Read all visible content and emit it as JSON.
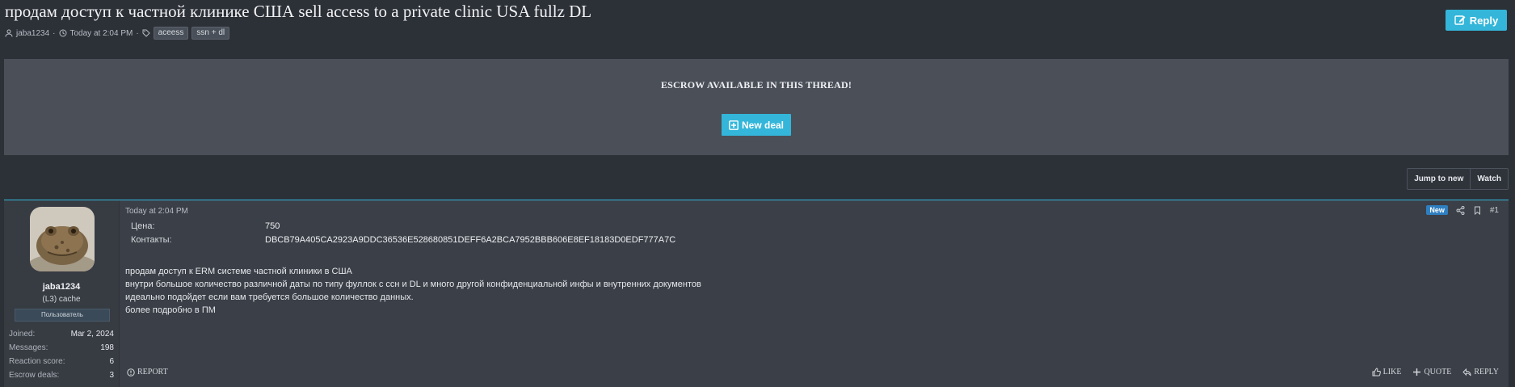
{
  "thread": {
    "title": "продам доступ к частной клинике США sell access to a private clinic USA fullz DL",
    "author": "jaba1234",
    "time": "Today at 2:04 PM",
    "tags": [
      "aceess",
      "ssn + dl"
    ],
    "reply_label": "Reply"
  },
  "escrow": {
    "text": "ESCROW AVAILABLE IN THIS THREAD!",
    "new_deal_label": "New deal"
  },
  "controls": {
    "jump_to_new": "Jump to new",
    "watch": "Watch"
  },
  "post": {
    "time": "Today at 2:04 PM",
    "badge_new": "New",
    "number": "#1",
    "fields": [
      {
        "label": "Цена:",
        "value": "750"
      },
      {
        "label": "Контакты:",
        "value": "DBCB79A405CA2923A9DDC36536E528680851DEFF6A2BCA7952BBB606E8EF18183D0EDF777A7C"
      }
    ],
    "body_lines": [
      "продам доступ к ERM системе частной клиники в США",
      "внутри большое количество различной даты по типу фуллок с ссн и DL и много другой конфиденциальной инфы и внутренних документов",
      "идеально подойдет если вам требуется большое количество данных.",
      "более подробно в ПМ"
    ],
    "report_label": "REPORT",
    "like_label": "LIKE",
    "quote_label": "QUOTE",
    "reply_label": "REPLY"
  },
  "user": {
    "name": "jaba1234",
    "title": "(L3) cache",
    "badge": "Пользователь",
    "stats": [
      {
        "label": "Joined:",
        "value": "Mar 2, 2024"
      },
      {
        "label": "Messages:",
        "value": "198"
      },
      {
        "label": "Reaction score:",
        "value": "6"
      },
      {
        "label": "Escrow deals:",
        "value": "3"
      }
    ]
  },
  "colors": {
    "accent": "#33b6d9",
    "background": "#2c3037",
    "panel": "#4a4f58",
    "post_bg": "#3b3f47"
  }
}
